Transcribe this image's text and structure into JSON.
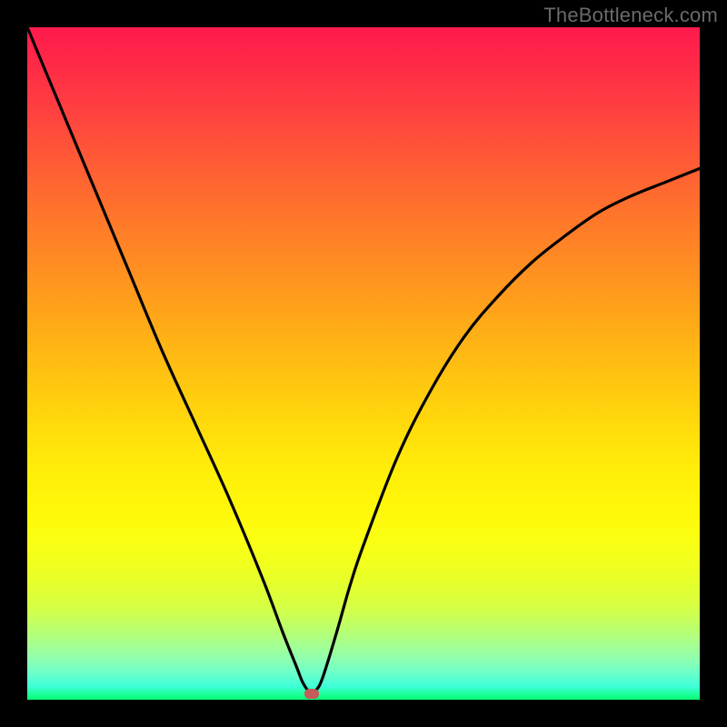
{
  "watermark": "TheBottleneck.com",
  "chart_data": {
    "type": "line",
    "title": "",
    "xlabel": "",
    "ylabel": "",
    "xlim": [
      0,
      100
    ],
    "ylim": [
      0,
      100
    ],
    "series": [
      {
        "name": "bottleneck-curve",
        "x": [
          0,
          5,
          10,
          15,
          20,
          25,
          30,
          35,
          38,
          40,
          41,
          42,
          43,
          44,
          46,
          48,
          50,
          55,
          60,
          65,
          70,
          75,
          80,
          85,
          90,
          95,
          100
        ],
        "values": [
          100,
          88,
          76,
          64,
          52,
          41,
          30,
          18,
          10,
          5,
          2.5,
          1.2,
          1.5,
          3.5,
          10,
          17,
          23,
          36,
          46,
          54,
          60,
          65,
          69,
          72.5,
          75,
          77,
          79
        ]
      }
    ],
    "marker": {
      "x": 42.3,
      "y": 1.0
    },
    "gradient_stops": [
      {
        "pos": 0.0,
        "color": "#ff1a4d"
      },
      {
        "pos": 0.5,
        "color": "#ffcc0d"
      },
      {
        "pos": 0.8,
        "color": "#eeff1d"
      },
      {
        "pos": 1.0,
        "color": "#05ff70"
      }
    ]
  }
}
